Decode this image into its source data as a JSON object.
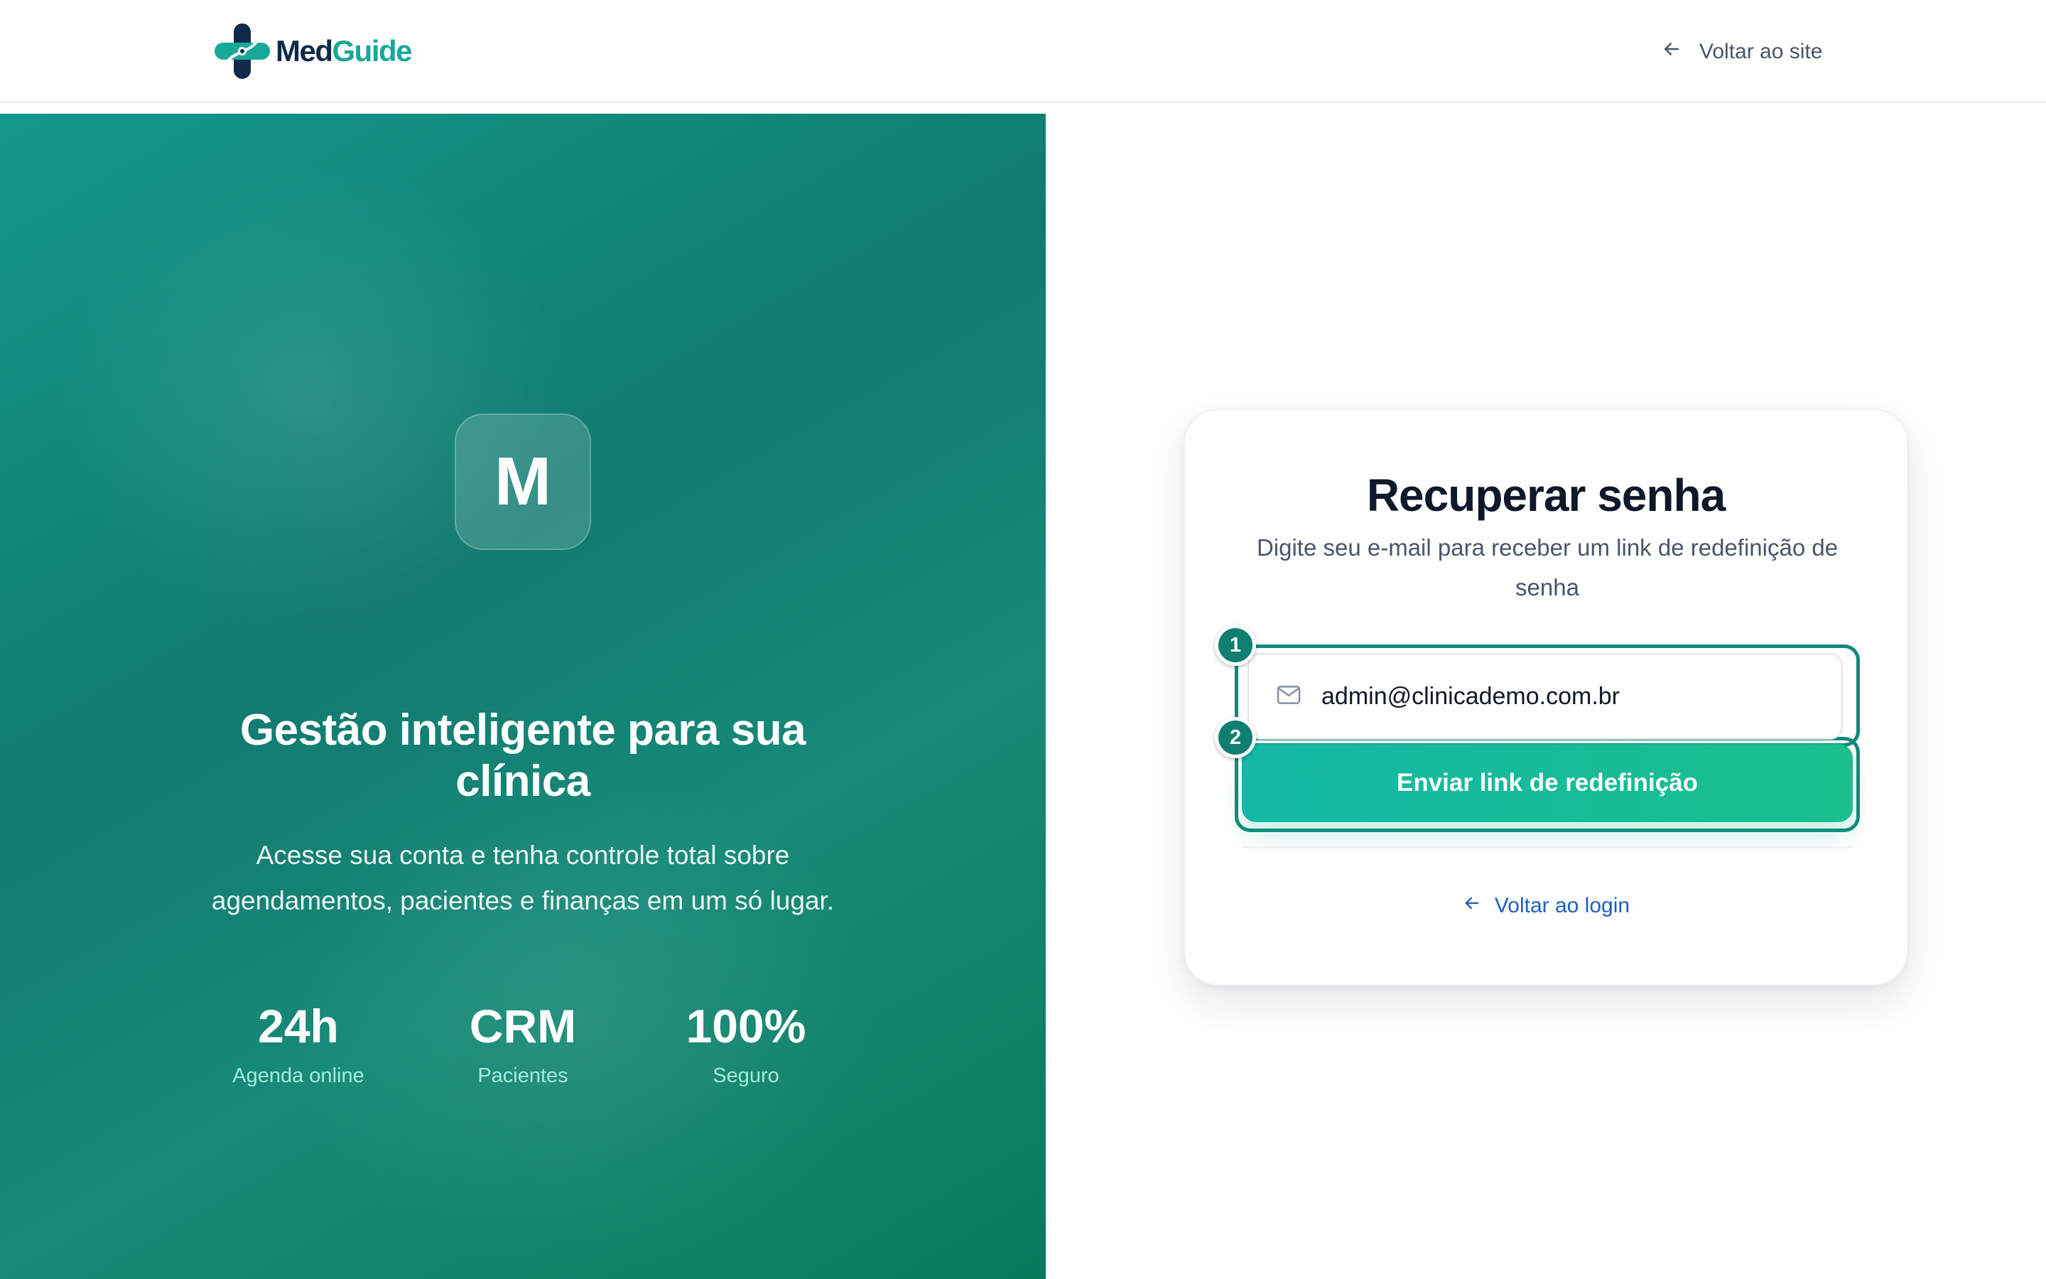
{
  "header": {
    "logo": {
      "text_primary": "Med",
      "text_secondary": "Guide",
      "icon": "medical-cross-logo"
    },
    "back_site": {
      "label": "Voltar ao site",
      "icon": "arrow-left-icon"
    }
  },
  "hero": {
    "badge_letter": "M",
    "title": "Gestão inteligente para sua clínica",
    "subtitle": "Acesse sua conta e tenha controle total sobre agendamentos, pacientes e finanças em um só lugar.",
    "stats": [
      {
        "value": "24h",
        "label": "Agenda online"
      },
      {
        "value": "CRM",
        "label": "Pacientes"
      },
      {
        "value": "100%",
        "label": "Seguro"
      }
    ]
  },
  "card": {
    "title": "Recuperar senha",
    "subtitle": "Digite seu e-mail para receber um link de redefinição de senha",
    "email": {
      "value": "admin@clinicademo.com.br",
      "icon": "mail-icon"
    },
    "submit_label": "Enviar link de redefinição",
    "back_login": {
      "label": "Voltar ao login",
      "icon": "arrow-left-icon"
    },
    "markers": [
      "1",
      "2"
    ]
  },
  "colors": {
    "brand_teal": "#18a89a",
    "brand_navy": "#0f2b4a",
    "hero_gradient_start": "#12988a",
    "hero_gradient_end": "#087a5a",
    "button_gradient_start": "#14b8a6",
    "button_gradient_end": "#19bf8c",
    "link_blue": "#1d5fbf",
    "marker": "#0f7f70"
  }
}
